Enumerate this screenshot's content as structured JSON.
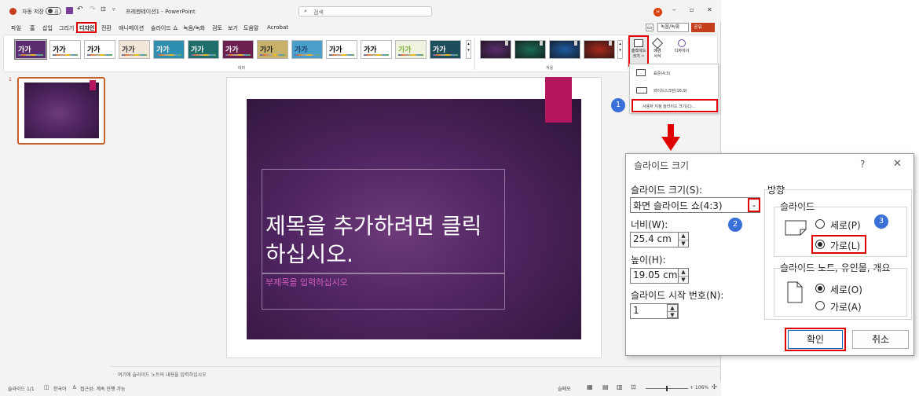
{
  "titlebar": {
    "autosave_label": "자동 저장",
    "autosave_state": "끔",
    "doc_title": "프레젠테이션1 - PowerPoint",
    "search_placeholder": "검색",
    "user_initial": "H",
    "colors": {
      "accent": "#c43e1c",
      "user": "#d83b01"
    }
  },
  "menu": {
    "items": [
      "파일",
      "홈",
      "삽입",
      "그리기",
      "디자인",
      "전환",
      "애니메이션",
      "슬라이드 쇼",
      "녹음/녹화",
      "검토",
      "보기",
      "도움말",
      "Acrobat"
    ],
    "active": "디자인",
    "record_button": "녹음/녹화",
    "share_button": "공유"
  },
  "ribbon": {
    "themes": [
      {
        "label": "가가",
        "bg": "#5b2d6e",
        "fg": "#ffffff"
      },
      {
        "label": "가가",
        "bg": "#ffffff",
        "fg": "#000000"
      },
      {
        "label": "가가",
        "bg": "#ffffff",
        "fg": "#000000"
      },
      {
        "label": "가가",
        "bg": "#f2e6d8",
        "fg": "#333333"
      },
      {
        "label": "가가",
        "bg": "#2f8fb0",
        "fg": "#ffffff"
      },
      {
        "label": "가가",
        "bg": "#1d6e6a",
        "fg": "#ffffff"
      },
      {
        "label": "가가",
        "bg": "#6b1f4f",
        "fg": "#ffffff"
      },
      {
        "label": "가가",
        "bg": "#c8b26a",
        "fg": "#222222"
      },
      {
        "label": "가가",
        "bg": "#4aa0c8",
        "fg": "#1a3a66"
      },
      {
        "label": "가가",
        "bg": "#ffffff",
        "fg": "#000000"
      },
      {
        "label": "가가",
        "bg": "#ffffff",
        "fg": "#000000"
      },
      {
        "label": "가가",
        "bg": "#eef4e0",
        "fg": "#7ab030"
      },
      {
        "label": "가가",
        "bg": "#1e4d5c",
        "fg": "#ffffff"
      }
    ],
    "variants": [
      {
        "bg": "#5b2d6e"
      },
      {
        "bg": "#1c6a58"
      },
      {
        "bg": "#1e5aa0"
      },
      {
        "bg": "#a8281e"
      }
    ],
    "group_theme_label": "테마",
    "group_variant_label": "적용",
    "slide_size_label_1": "슬라이드",
    "slide_size_label_2": "크기 ~",
    "bg_format_label_1": "배경",
    "bg_format_label_2": "서식",
    "designer_label": "디자이너"
  },
  "dropdown": {
    "items": [
      "표준(4:3)",
      "와이드스크린(16:9)",
      "사용자 지정 슬라이드 크기(C)..."
    ]
  },
  "thumbpane": {
    "slide_number": "1"
  },
  "slide": {
    "title": "제목을 추가하려면 클릭하십시오.",
    "subtitle": "부제목을 입력하십시오",
    "colors": {
      "bg_center": "#6e3a7a",
      "bg_edge": "#2e1438",
      "accent_tab": "#b5175e",
      "subtitle_color": "#d060c0"
    }
  },
  "notes": {
    "placeholder": "여기에 슬라이드 노트의 내용을 입력하십시오"
  },
  "status": {
    "slide_count": "슬라이드 1/1",
    "language": "한국어",
    "accessibility": "접근성: 계속 진행 가능",
    "notes_button": "슬메모",
    "zoom": "+ 106%"
  },
  "dialog": {
    "title": "슬라이드 크기",
    "help": "?",
    "close": "✕",
    "size_label": "슬라이드 크기(S):",
    "size_value": "화면 슬라이드 쇼(4:3)",
    "width_label": "너비(W):",
    "width_value": "25.4 cm",
    "height_label": "높이(H):",
    "height_value": "19.05 cm",
    "start_label": "슬라이드 시작 번호(N):",
    "start_value": "1",
    "orientation_label": "방향",
    "slides_label": "슬라이드",
    "portrait_label": "세로(P)",
    "landscape_label": "가로(L)",
    "notes_label": "슬라이드 노트, 유인물, 개요",
    "notes_portrait_label": "세로(O)",
    "notes_landscape_label": "가로(A)",
    "ok": "확인",
    "cancel": "취소"
  },
  "annotations": {
    "step1": "1",
    "step2": "2",
    "step3": "3",
    "colors": {
      "highlight": "#e00000",
      "badge": "#3a6fd8"
    }
  }
}
